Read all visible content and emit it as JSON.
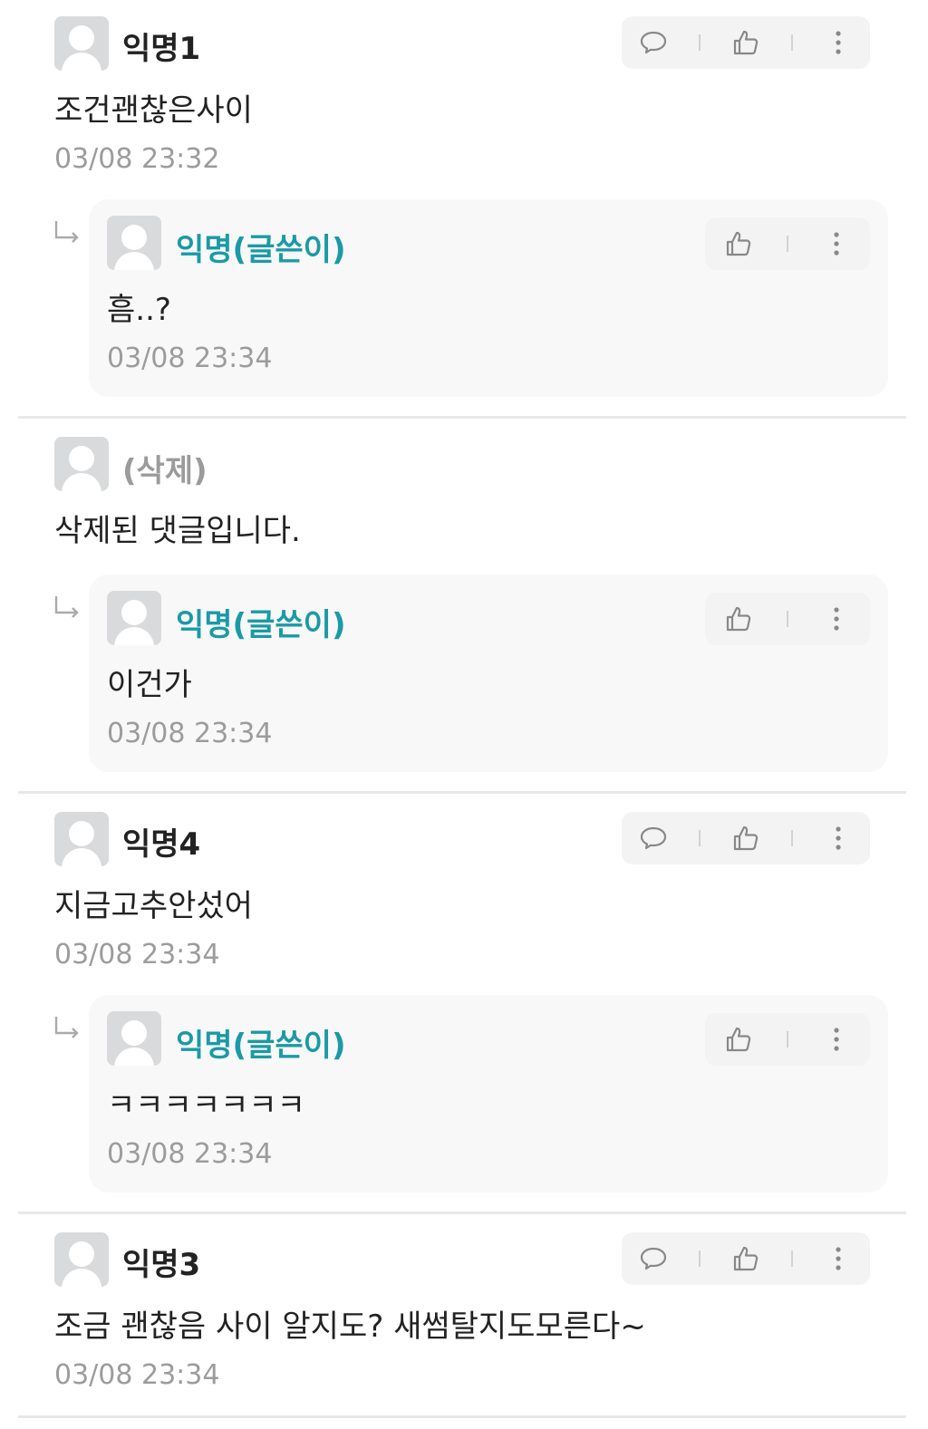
{
  "comments": [
    {
      "author": "익명1",
      "text": "조건괜찮은사이",
      "time": "03/08 23:32",
      "reply": {
        "author": "익명(글쓴이)",
        "text": "흠..?",
        "time": "03/08 23:34"
      }
    },
    {
      "author": "(삭제)",
      "text": "삭제된 댓글입니다.",
      "reply": {
        "author": "익명(글쓴이)",
        "text": "이건가",
        "time": "03/08 23:34"
      }
    },
    {
      "author": "익명4",
      "text": "지금고추안섰어",
      "time": "03/08 23:34",
      "reply": {
        "author": "익명(글쓴이)",
        "text": "ㅋㅋㅋㅋㅋㅋㅋ",
        "time": "03/08 23:34"
      }
    },
    {
      "author": "익명3",
      "text": "조금 괜찮음 사이 알지도? 새썸탈지도모른다~",
      "time": "03/08 23:34"
    }
  ],
  "icons": {
    "comment": "comment-bubble-icon",
    "like": "thumbs-up-icon",
    "more": "more-vertical-icon",
    "reply": "reply-arrow-icon"
  },
  "colors": {
    "author_name": "#1a9aa6",
    "deleted_name": "#9b9b9b",
    "timestamp": "#9c9c9c",
    "action_bg": "#f3f3f3",
    "reply_bg": "#f8f8f8"
  }
}
